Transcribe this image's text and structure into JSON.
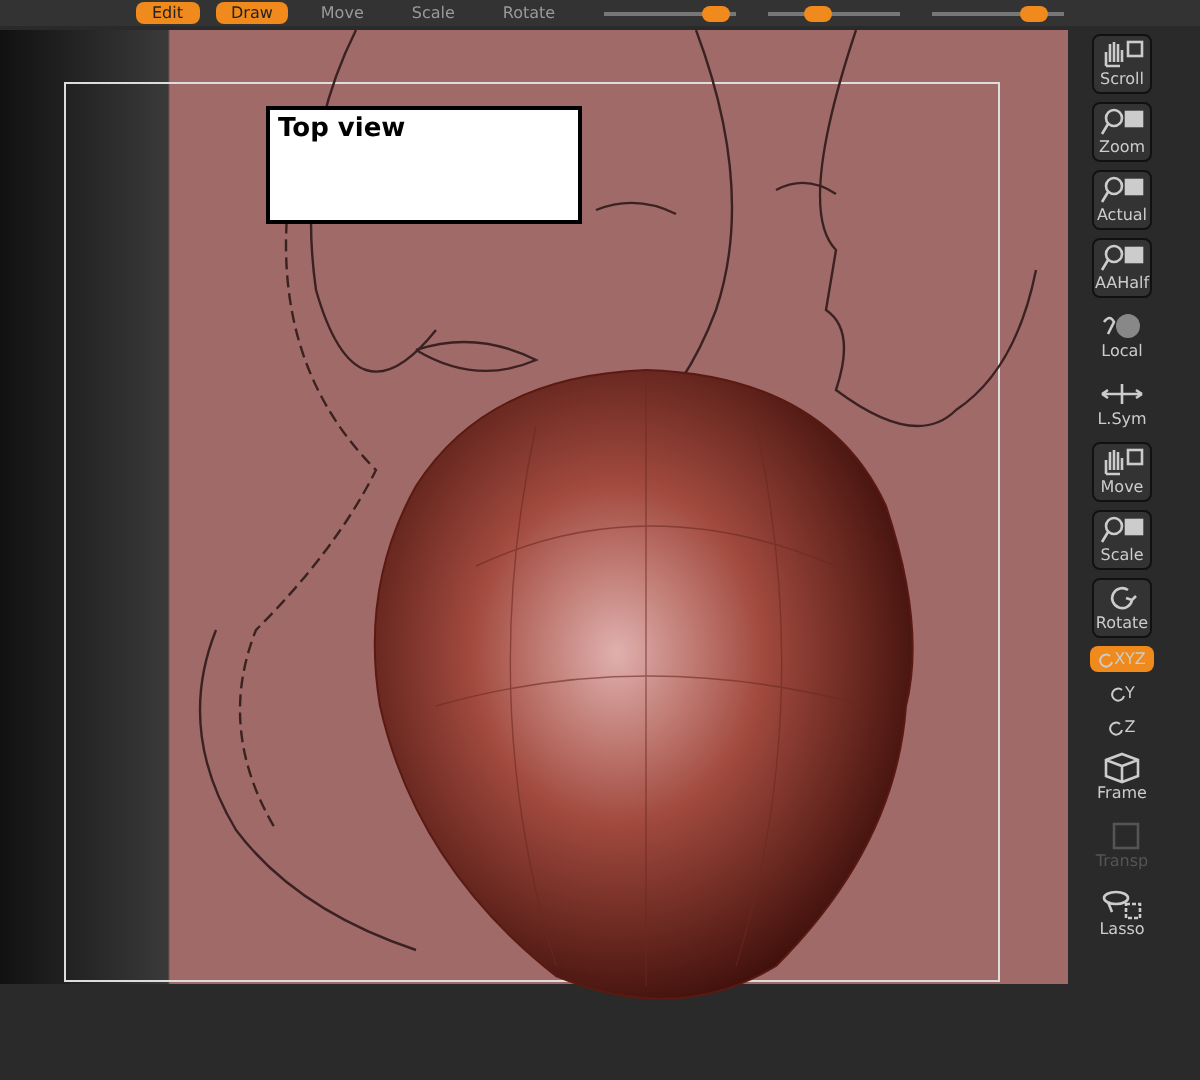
{
  "top_bar": {
    "modes": [
      {
        "label": "Edit",
        "selected": true
      },
      {
        "label": "Draw",
        "selected": true
      },
      {
        "label": "Move",
        "selected": false
      },
      {
        "label": "Scale",
        "selected": false
      },
      {
        "label": "Rotate",
        "selected": false
      }
    ],
    "sliders": [
      {
        "level": 0.95
      },
      {
        "level": 0.35
      },
      {
        "level": 0.85
      }
    ]
  },
  "canvas": {
    "label": "Top view"
  },
  "toolbar": [
    {
      "label": "Scroll",
      "kind": "button",
      "on": false,
      "disabled": false
    },
    {
      "label": "Zoom",
      "kind": "button",
      "on": false,
      "disabled": false
    },
    {
      "label": "Actual",
      "kind": "button",
      "on": false,
      "disabled": false
    },
    {
      "label": "AAHalf",
      "kind": "button",
      "on": false,
      "disabled": false
    },
    {
      "label": "Local",
      "kind": "plain",
      "on": false,
      "disabled": false
    },
    {
      "label": "L.Sym",
      "kind": "plain",
      "on": false,
      "disabled": false
    },
    {
      "label": "Move",
      "kind": "button",
      "on": false,
      "disabled": false
    },
    {
      "label": "Scale",
      "kind": "button",
      "on": false,
      "disabled": false
    },
    {
      "label": "Rotate",
      "kind": "button",
      "on": false,
      "disabled": false
    },
    {
      "label": "XYZ",
      "kind": "small",
      "on": true,
      "disabled": false
    },
    {
      "label": "Y",
      "kind": "small",
      "on": false,
      "disabled": false
    },
    {
      "label": "Z",
      "kind": "small",
      "on": false,
      "disabled": false
    },
    {
      "label": "Frame",
      "kind": "plain",
      "on": false,
      "disabled": false
    },
    {
      "label": "Transp",
      "kind": "plain",
      "on": false,
      "disabled": true
    },
    {
      "label": "Lasso",
      "kind": "plain",
      "on": false,
      "disabled": false
    }
  ]
}
